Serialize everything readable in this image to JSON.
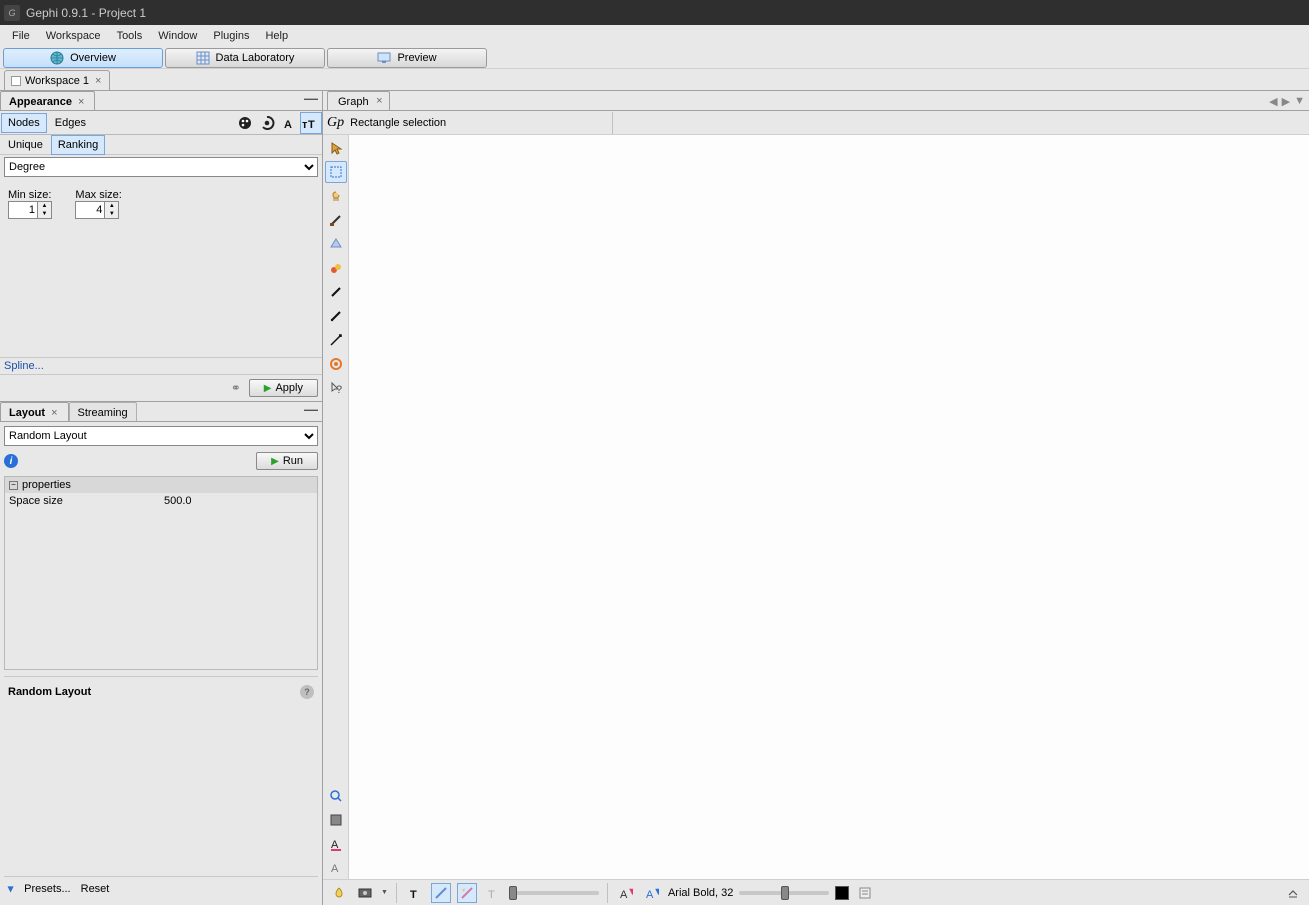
{
  "title": "Gephi 0.9.1 - Project 1",
  "menu": {
    "file": "File",
    "workspace": "Workspace",
    "tools": "Tools",
    "window": "Window",
    "plugins": "Plugins",
    "help": "Help"
  },
  "perspectives": {
    "overview": "Overview",
    "datalab": "Data Laboratory",
    "preview": "Preview"
  },
  "workspace_tab": "Workspace 1",
  "appearance": {
    "title": "Appearance",
    "nodes": "Nodes",
    "edges": "Edges",
    "unique": "Unique",
    "ranking": "Ranking",
    "attribute": "Degree",
    "min_label": "Min size:",
    "min_value": "1",
    "max_label": "Max size:",
    "max_value": "4",
    "spline": "Spline...",
    "apply": "Apply"
  },
  "layout": {
    "tab_layout": "Layout",
    "tab_streaming": "Streaming",
    "algorithm": "Random Layout",
    "run": "Run",
    "props_header": "properties",
    "prop_key": "Space size",
    "prop_val": "500.0",
    "name": "Random Layout",
    "presets": "Presets...",
    "reset": "Reset"
  },
  "graph": {
    "tab": "Graph",
    "tool_hint": "Rectangle selection",
    "font": "Arial Bold, 32"
  }
}
